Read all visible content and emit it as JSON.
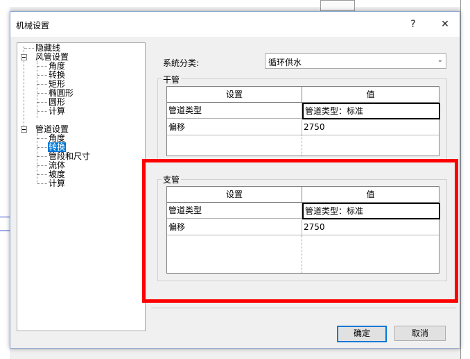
{
  "dialog": {
    "title": "机械设置",
    "help_label": "?",
    "close_label": "✕"
  },
  "tree": {
    "items": [
      {
        "label": "隐藏线"
      },
      {
        "label": "风管设置"
      },
      {
        "label": "角度"
      },
      {
        "label": "转换"
      },
      {
        "label": "矩形"
      },
      {
        "label": "椭圆形"
      },
      {
        "label": "圆形"
      },
      {
        "label": "计算"
      },
      {
        "label": "管道设置"
      },
      {
        "label": "角度"
      },
      {
        "label": "转换"
      },
      {
        "label": "管段和尺寸"
      },
      {
        "label": "流体"
      },
      {
        "label": "坡度"
      },
      {
        "label": "计算"
      }
    ],
    "selected_index": 10
  },
  "system": {
    "label": "系统分类:",
    "value": "循环供水"
  },
  "main_pipe": {
    "title": "干管",
    "headers": [
      "设置",
      "值"
    ],
    "rows": [
      [
        "管道类型",
        "管道类型：标准"
      ],
      [
        "偏移",
        "2750"
      ]
    ]
  },
  "branch_pipe": {
    "title": "支管",
    "headers": [
      "设置",
      "值"
    ],
    "rows": [
      [
        "管道类型",
        "管道类型：标准"
      ],
      [
        "偏移",
        "2750"
      ]
    ]
  },
  "buttons": {
    "ok": "确定",
    "cancel": "取消"
  },
  "highlight_color": "#ff0000",
  "selection_color": "#0078d7"
}
